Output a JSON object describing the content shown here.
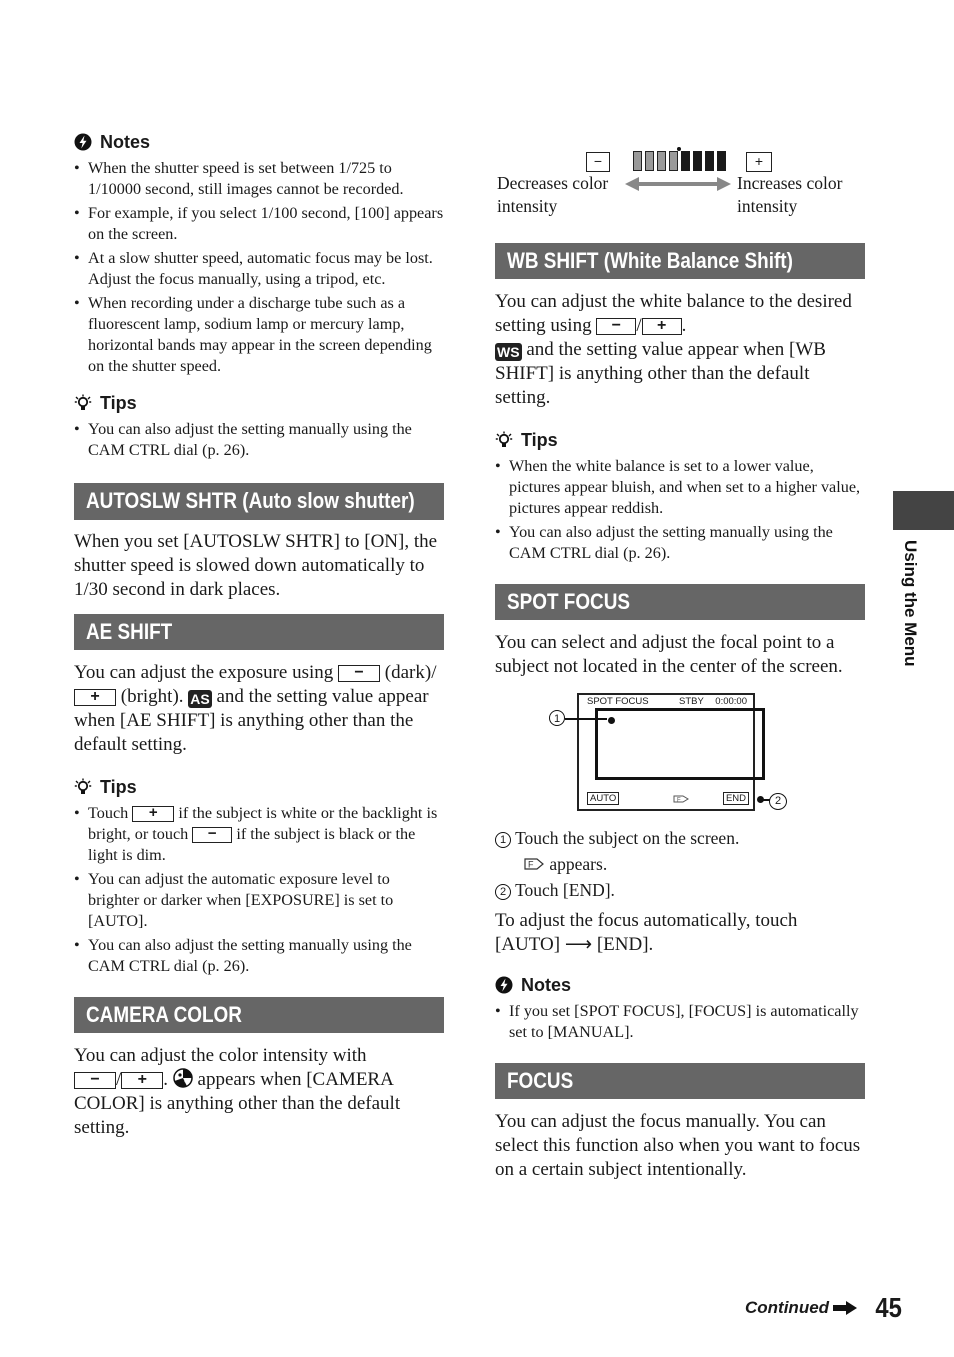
{
  "left": {
    "notes_title": "Notes",
    "notes": [
      "When the shutter speed is set between 1/725 to 1/10000 second, still images cannot be recorded.",
      "For example, if you select 1/100 second, [100] appears on the screen.",
      "At a slow shutter speed, automatic focus may be lost. Adjust the focus manually, using a tripod, etc.",
      "When recording under a discharge tube such as a fluorescent lamp, sodium lamp or mercury lamp, horizontal bands may appear in the screen depending on the shutter speed."
    ],
    "tips1_title": "Tips",
    "tips1": [
      "You can also adjust the setting manually using the CAM CTRL dial (p. 26)."
    ],
    "autoslw": {
      "heading": "AUTOSLW SHTR (Auto slow shutter)",
      "body": "When you set [AUTOSLW SHTR] to [ON], the shutter speed is slowed down automatically to 1/30 second in dark places."
    },
    "ae_shift": {
      "heading": "AE SHIFT",
      "body_a": "You can adjust the exposure using",
      "body_b": "(dark)/",
      "body_c": "(bright).",
      "badge": "AS",
      "body_d": "and the setting value appear when [AE SHIFT] is anything other than the default setting.",
      "tips_title": "Tips",
      "tip1_a": "Touch",
      "tip1_b": "if the subject is white or the backlight is bright, or touch",
      "tip1_c": "if the subject is black or the light is dim.",
      "tip2": "You can adjust the automatic exposure level to brighter or darker when [EXPOSURE] is set to [AUTO].",
      "tip3": "You can also adjust the setting manually using the CAM CTRL dial (p. 26)."
    },
    "camera_color": {
      "heading": "CAMERA COLOR",
      "body_a": "You can adjust the color intensity with",
      "body_b": "appears when [CAMERA COLOR] is anything other than the default setting."
    }
  },
  "right": {
    "color_scale": {
      "minus": "−",
      "plus": "+",
      "left_label": "Decreases color intensity",
      "right_label": "Increases color intensity",
      "level_fraction": 0.5
    },
    "wb_shift": {
      "heading": "WB SHIFT (White Balance Shift)",
      "body_a": "You can adjust the white balance to the desired setting using",
      "badge": "WS",
      "body_b": "and the setting value appear when [WB SHIFT] is anything other than the default setting.",
      "tips_title": "Tips",
      "tips": [
        "When the white balance is set to a lower value, pictures appear bluish, and when set to a higher value, pictures appear reddish.",
        "You can also adjust the setting manually using the CAM CTRL dial (p. 26)."
      ]
    },
    "spot_focus": {
      "heading": "SPOT FOCUS",
      "body": "You can select and adjust the focal point to a subject not located in the center of the screen.",
      "screen": {
        "mode": "SPOT FOCUS",
        "status": "STBY",
        "time": "0:00:00",
        "auto_btn": "AUTO",
        "end_btn": "END",
        "callout1": "1",
        "callout2": "2"
      },
      "steps": [
        {
          "num": "1",
          "text": "Touch the subject on the screen."
        },
        {
          "num": "",
          "text": "appears."
        },
        {
          "num": "2",
          "text": "Touch [END]."
        }
      ],
      "auto_text_a": "To adjust the focus automatically, touch",
      "auto_text_b": "[AUTO]",
      "auto_text_c": "[END].",
      "notes_title": "Notes",
      "notes": [
        "If you set [SPOT FOCUS], [FOCUS] is automatically set to [MANUAL]."
      ]
    },
    "focus": {
      "heading": "FOCUS",
      "body": "You can adjust the focus manually. You can select this function also when you want to focus on a certain subject intentionally."
    }
  },
  "side_tab": {
    "label": "Using the Menu"
  },
  "footer": {
    "continued": "Continued",
    "page_number": "45"
  },
  "buttons": {
    "minus": "−",
    "plus": "+"
  }
}
